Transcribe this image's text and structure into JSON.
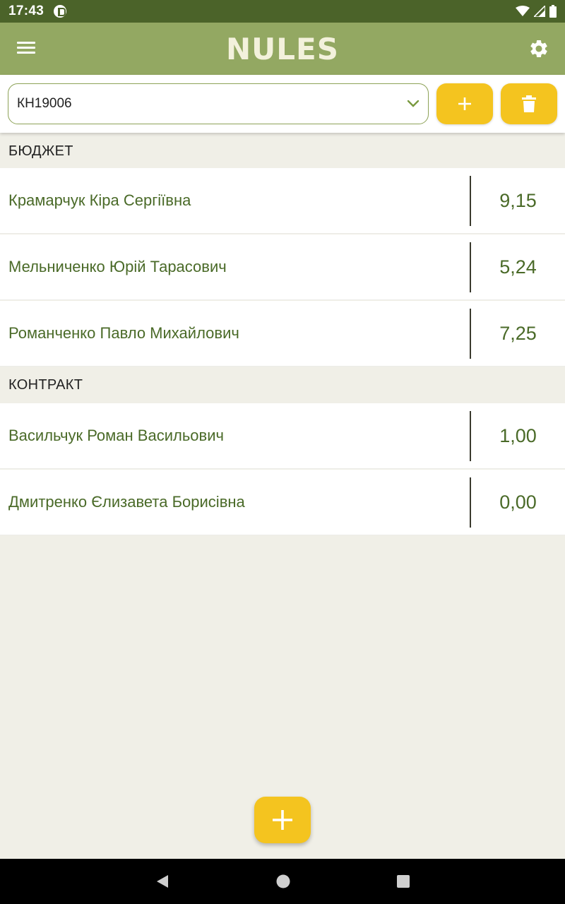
{
  "status_bar": {
    "time": "17:43"
  },
  "app_bar": {
    "title": "NULES",
    "menu_icon": "hamburger-menu-icon",
    "settings_icon": "gear-icon"
  },
  "toolbar": {
    "group_value": "КН19006",
    "dropdown_icon": "chevron-down-icon",
    "add_icon": "plus-icon",
    "delete_icon": "trash-icon"
  },
  "sections": [
    {
      "title": "БЮДЖЕТ",
      "students": [
        {
          "name": "Крамарчук Кіра Сергіївна",
          "score": "9,15"
        },
        {
          "name": "Мельниченко Юрій Тарасович",
          "score": "5,24"
        },
        {
          "name": "Романченко Павло Михайлович",
          "score": "7,25"
        }
      ]
    },
    {
      "title": "КОНТРАКТ",
      "students": [
        {
          "name": "Васильчук Роман Васильович",
          "score": "1,00"
        },
        {
          "name": "Дмитренко Єлизавета Борисівна",
          "score": "0,00"
        }
      ]
    }
  ],
  "colors": {
    "status_bar": "#4b6329",
    "app_bar": "#93a862",
    "accent": "#f4c41f",
    "text_green": "#4a6a28",
    "background": "#f0efe7"
  }
}
